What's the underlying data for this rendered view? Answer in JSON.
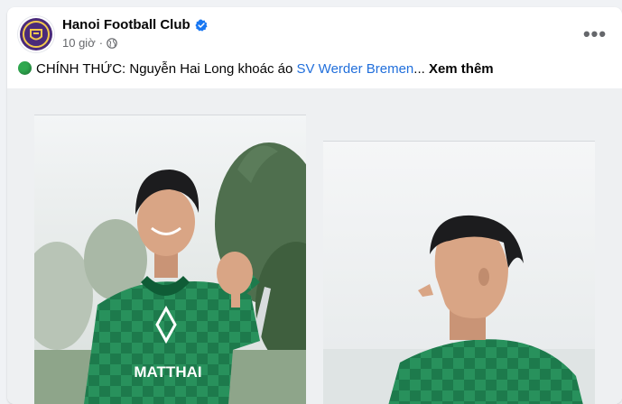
{
  "post": {
    "page_name": "Hanoi Football Club",
    "verified_icon": "verified-badge-icon",
    "time": "10 giờ",
    "separator": "·",
    "privacy_icon": "globe-icon",
    "more_icon": "more-options-icon",
    "more_label": "•••",
    "text_prefix": "CHÍNH THỨC: Nguyễn Hai Long khoác áo ",
    "link_text": "SV Werder Bremen",
    "ellipsis": "... ",
    "see_more": "Xem thêm",
    "status_icon": "green-circle-icon"
  },
  "colors": {
    "link": "#216fdb",
    "status_green": "#2fa84f",
    "jersey_green": "#1f7a4d",
    "club_purple": "#4a2a7a"
  },
  "media": {
    "photos": [
      {
        "name": "player-pointing-photo",
        "jersey_text": "MATTHAI"
      },
      {
        "name": "player-profile-photo"
      }
    ]
  }
}
